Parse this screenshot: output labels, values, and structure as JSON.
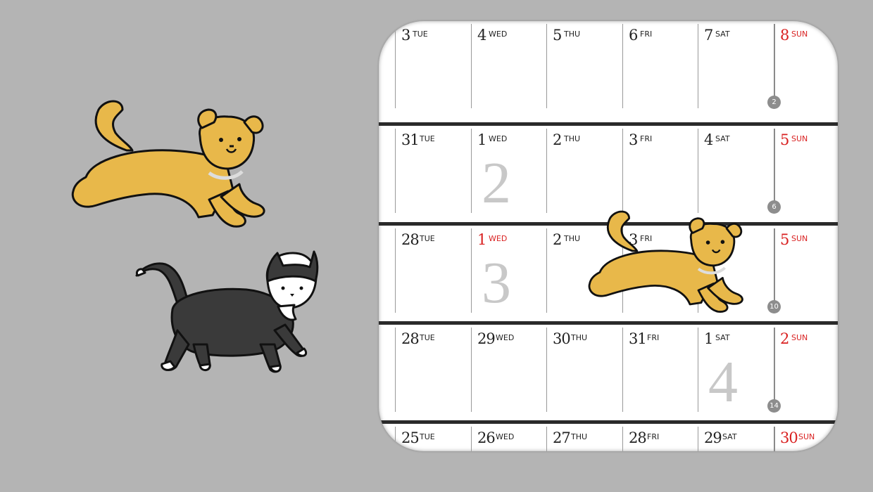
{
  "colors": {
    "background": "#b4b4b4",
    "sunday": "#d92020",
    "dog": "#e8b84a",
    "cat": "#3a3a3a"
  },
  "stickers": [
    {
      "name": "dog-sticker-left",
      "icon": "dog-icon"
    },
    {
      "name": "cat-sticker",
      "icon": "cat-icon"
    },
    {
      "name": "dog-sticker-calendar",
      "icon": "dog-icon"
    }
  ],
  "calendar": {
    "weeks": [
      {
        "big": "",
        "week_badge": "2",
        "days": [
          {
            "num": "3",
            "dow": "TUE",
            "red": false
          },
          {
            "num": "4",
            "dow": "WED",
            "red": false
          },
          {
            "num": "5",
            "dow": "THU",
            "red": false
          },
          {
            "num": "6",
            "dow": "FRI",
            "red": false
          },
          {
            "num": "7",
            "dow": "SAT",
            "red": false
          },
          {
            "num": "8",
            "dow": "SUN",
            "red": true
          }
        ]
      },
      {
        "big": "2",
        "big_col": 1,
        "week_badge": "6",
        "days": [
          {
            "num": "31",
            "dow": "TUE",
            "red": false
          },
          {
            "num": "1",
            "dow": "WED",
            "red": false
          },
          {
            "num": "2",
            "dow": "THU",
            "red": false
          },
          {
            "num": "3",
            "dow": "FRI",
            "red": false
          },
          {
            "num": "4",
            "dow": "SAT",
            "red": false
          },
          {
            "num": "5",
            "dow": "SUN",
            "red": true
          }
        ]
      },
      {
        "big": "3",
        "big_col": 1,
        "week_badge": "10",
        "days": [
          {
            "num": "28",
            "dow": "TUE",
            "red": false
          },
          {
            "num": "1",
            "dow": "WED",
            "red": true
          },
          {
            "num": "2",
            "dow": "THU",
            "red": false
          },
          {
            "num": "3",
            "dow": "FRI",
            "red": false
          },
          {
            "num": "",
            "dow": "",
            "red": false
          },
          {
            "num": "5",
            "dow": "SUN",
            "red": true
          }
        ]
      },
      {
        "big": "4",
        "big_col": 4,
        "week_badge": "14",
        "days": [
          {
            "num": "28",
            "dow": "TUE",
            "red": false
          },
          {
            "num": "29",
            "dow": "WED",
            "red": false
          },
          {
            "num": "30",
            "dow": "THU",
            "red": false
          },
          {
            "num": "31",
            "dow": "FRI",
            "red": false
          },
          {
            "num": "1",
            "dow": "SAT",
            "red": false
          },
          {
            "num": "2",
            "dow": "SUN",
            "red": true
          }
        ]
      },
      {
        "big": "",
        "week_badge": "",
        "days": [
          {
            "num": "25",
            "dow": "TUE",
            "red": false
          },
          {
            "num": "26",
            "dow": "WED",
            "red": false
          },
          {
            "num": "27",
            "dow": "THU",
            "red": false
          },
          {
            "num": "28",
            "dow": "FRI",
            "red": false
          },
          {
            "num": "29",
            "dow": "SAT",
            "red": false
          },
          {
            "num": "30",
            "dow": "SUN",
            "red": true
          }
        ]
      }
    ]
  }
}
